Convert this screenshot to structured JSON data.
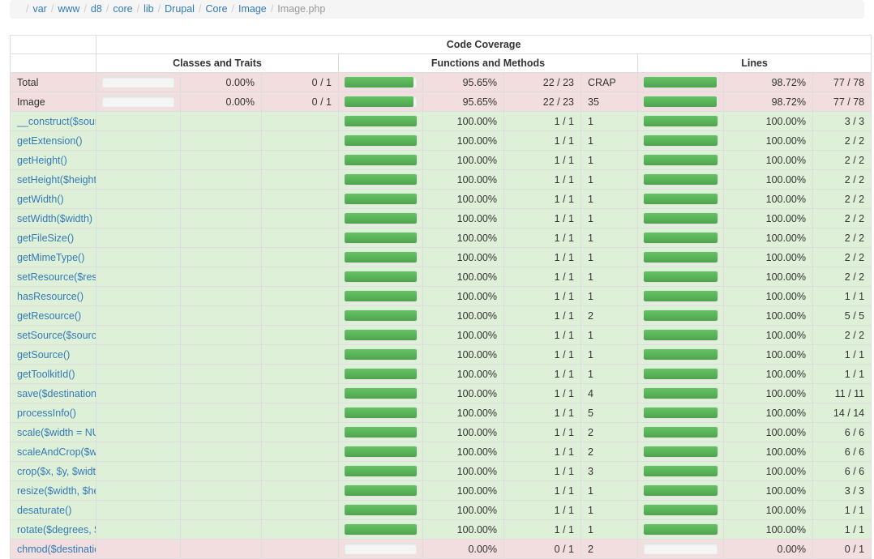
{
  "breadcrumb": {
    "separator": "/",
    "items": [
      {
        "label": "var",
        "active": false
      },
      {
        "label": "www",
        "active": false
      },
      {
        "label": "d8",
        "active": false
      },
      {
        "label": "core",
        "active": false
      },
      {
        "label": "lib",
        "active": false
      },
      {
        "label": "Drupal",
        "active": false
      },
      {
        "label": "Core",
        "active": false
      },
      {
        "label": "Image",
        "active": false
      },
      {
        "label": "Image.php",
        "active": true
      }
    ]
  },
  "table": {
    "top_header": "Code Coverage",
    "group_headers": [
      "",
      "Classes and Traits",
      "Functions and Methods",
      "Lines"
    ],
    "colors": {
      "bar_green": "#5cb85c",
      "row_success": "#dff0d8",
      "row_danger": "#f2dede",
      "link": "#337ab7",
      "border": "#dddddd",
      "breadcrumb_bg": "#f5f5f5"
    },
    "summary_rows": [
      {
        "name": "Total",
        "status": "danger",
        "classes": {
          "pct": "0.00%",
          "frac": "0 / 1",
          "bar": 0
        },
        "functions": {
          "pct": "95.65%",
          "frac": "22 / 23",
          "bar": 95.65,
          "crap": "CRAP"
        },
        "lines": {
          "pct": "98.72%",
          "frac": "77 / 78",
          "bar": 98.72
        }
      },
      {
        "name": "Image",
        "status": "danger",
        "classes": {
          "pct": "0.00%",
          "frac": "0 / 1",
          "bar": 0
        },
        "functions": {
          "pct": "95.65%",
          "frac": "22 / 23",
          "bar": 95.65,
          "crap": "35"
        },
        "lines": {
          "pct": "98.72%",
          "frac": "77 / 78",
          "bar": 98.72
        }
      }
    ],
    "method_rows": [
      {
        "name": "__construct($source, ImageToolkitInterface $toolkit)",
        "status": "success",
        "functions": {
          "pct": "100.00%",
          "frac": "1 / 1",
          "bar": 100,
          "crap": "1"
        },
        "lines": {
          "pct": "100.00%",
          "frac": "3 / 3",
          "bar": 100
        }
      },
      {
        "name": "getExtension()",
        "status": "success",
        "functions": {
          "pct": "100.00%",
          "frac": "1 / 1",
          "bar": 100,
          "crap": "1"
        },
        "lines": {
          "pct": "100.00%",
          "frac": "2 / 2",
          "bar": 100
        }
      },
      {
        "name": "getHeight()",
        "status": "success",
        "functions": {
          "pct": "100.00%",
          "frac": "1 / 1",
          "bar": 100,
          "crap": "1"
        },
        "lines": {
          "pct": "100.00%",
          "frac": "2 / 2",
          "bar": 100
        }
      },
      {
        "name": "setHeight($height)",
        "status": "success",
        "functions": {
          "pct": "100.00%",
          "frac": "1 / 1",
          "bar": 100,
          "crap": "1"
        },
        "lines": {
          "pct": "100.00%",
          "frac": "2 / 2",
          "bar": 100
        }
      },
      {
        "name": "getWidth()",
        "status": "success",
        "functions": {
          "pct": "100.00%",
          "frac": "1 / 1",
          "bar": 100,
          "crap": "1"
        },
        "lines": {
          "pct": "100.00%",
          "frac": "2 / 2",
          "bar": 100
        }
      },
      {
        "name": "setWidth($width)",
        "status": "success",
        "functions": {
          "pct": "100.00%",
          "frac": "1 / 1",
          "bar": 100,
          "crap": "1"
        },
        "lines": {
          "pct": "100.00%",
          "frac": "2 / 2",
          "bar": 100
        }
      },
      {
        "name": "getFileSize()",
        "status": "success",
        "functions": {
          "pct": "100.00%",
          "frac": "1 / 1",
          "bar": 100,
          "crap": "1"
        },
        "lines": {
          "pct": "100.00%",
          "frac": "2 / 2",
          "bar": 100
        }
      },
      {
        "name": "getMimeType()",
        "status": "success",
        "functions": {
          "pct": "100.00%",
          "frac": "1 / 1",
          "bar": 100,
          "crap": "1"
        },
        "lines": {
          "pct": "100.00%",
          "frac": "2 / 2",
          "bar": 100
        }
      },
      {
        "name": "setResource($resource)",
        "status": "success",
        "functions": {
          "pct": "100.00%",
          "frac": "1 / 1",
          "bar": 100,
          "crap": "1"
        },
        "lines": {
          "pct": "100.00%",
          "frac": "2 / 2",
          "bar": 100
        }
      },
      {
        "name": "hasResource()",
        "status": "success",
        "functions": {
          "pct": "100.00%",
          "frac": "1 / 1",
          "bar": 100,
          "crap": "1"
        },
        "lines": {
          "pct": "100.00%",
          "frac": "1 / 1",
          "bar": 100
        }
      },
      {
        "name": "getResource()",
        "status": "success",
        "functions": {
          "pct": "100.00%",
          "frac": "1 / 1",
          "bar": 100,
          "crap": "2"
        },
        "lines": {
          "pct": "100.00%",
          "frac": "5 / 5",
          "bar": 100
        }
      },
      {
        "name": "setSource($source)",
        "status": "success",
        "functions": {
          "pct": "100.00%",
          "frac": "1 / 1",
          "bar": 100,
          "crap": "1"
        },
        "lines": {
          "pct": "100.00%",
          "frac": "2 / 2",
          "bar": 100
        }
      },
      {
        "name": "getSource()",
        "status": "success",
        "functions": {
          "pct": "100.00%",
          "frac": "1 / 1",
          "bar": 100,
          "crap": "1"
        },
        "lines": {
          "pct": "100.00%",
          "frac": "1 / 1",
          "bar": 100
        }
      },
      {
        "name": "getToolkitId()",
        "status": "success",
        "functions": {
          "pct": "100.00%",
          "frac": "1 / 1",
          "bar": 100,
          "crap": "1"
        },
        "lines": {
          "pct": "100.00%",
          "frac": "1 / 1",
          "bar": 100
        }
      },
      {
        "name": "save($destination = NULL)",
        "status": "success",
        "functions": {
          "pct": "100.00%",
          "frac": "1 / 1",
          "bar": 100,
          "crap": "4"
        },
        "lines": {
          "pct": "100.00%",
          "frac": "11 / 11",
          "bar": 100
        }
      },
      {
        "name": "processInfo()",
        "status": "success",
        "functions": {
          "pct": "100.00%",
          "frac": "1 / 1",
          "bar": 100,
          "crap": "5"
        },
        "lines": {
          "pct": "100.00%",
          "frac": "14 / 14",
          "bar": 100
        }
      },
      {
        "name": "scale($width = NULL, $height = NULL, $upscale = FALSE)",
        "status": "success",
        "functions": {
          "pct": "100.00%",
          "frac": "1 / 1",
          "bar": 100,
          "crap": "2"
        },
        "lines": {
          "pct": "100.00%",
          "frac": "6 / 6",
          "bar": 100
        }
      },
      {
        "name": "scaleAndCrop($width, $height)",
        "status": "success",
        "functions": {
          "pct": "100.00%",
          "frac": "1 / 1",
          "bar": 100,
          "crap": "2"
        },
        "lines": {
          "pct": "100.00%",
          "frac": "6 / 6",
          "bar": 100
        }
      },
      {
        "name": "crop($x, $y, $width, $height)",
        "status": "success",
        "functions": {
          "pct": "100.00%",
          "frac": "1 / 1",
          "bar": 100,
          "crap": "3"
        },
        "lines": {
          "pct": "100.00%",
          "frac": "6 / 6",
          "bar": 100
        }
      },
      {
        "name": "resize($width, $height)",
        "status": "success",
        "functions": {
          "pct": "100.00%",
          "frac": "1 / 1",
          "bar": 100,
          "crap": "1"
        },
        "lines": {
          "pct": "100.00%",
          "frac": "3 / 3",
          "bar": 100
        }
      },
      {
        "name": "desaturate()",
        "status": "success",
        "functions": {
          "pct": "100.00%",
          "frac": "1 / 1",
          "bar": 100,
          "crap": "1"
        },
        "lines": {
          "pct": "100.00%",
          "frac": "1 / 1",
          "bar": 100
        }
      },
      {
        "name": "rotate($degrees, $background = NULL)",
        "status": "success",
        "functions": {
          "pct": "100.00%",
          "frac": "1 / 1",
          "bar": 100,
          "crap": "1"
        },
        "lines": {
          "pct": "100.00%",
          "frac": "1 / 1",
          "bar": 100
        }
      },
      {
        "name": "chmod($destination)",
        "status": "danger",
        "functions": {
          "pct": "0.00%",
          "frac": "0 / 1",
          "bar": 0,
          "crap": "2"
        },
        "lines": {
          "pct": "0.00%",
          "frac": "0 / 1",
          "bar": 0
        }
      }
    ]
  }
}
